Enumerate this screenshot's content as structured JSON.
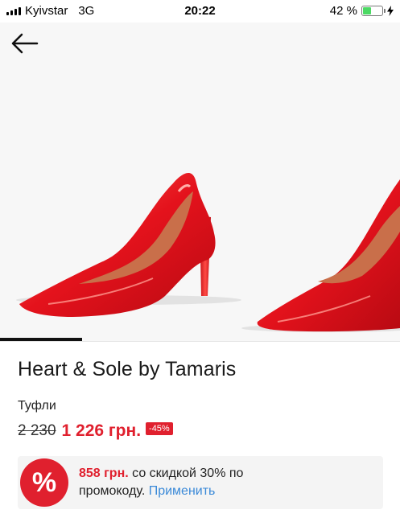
{
  "status_bar": {
    "carrier": "Kyivstar",
    "network": "3G",
    "time": "20:22",
    "battery_percent": "42 %",
    "battery_level": 0.42
  },
  "icons": {
    "back": "arrow-left-icon",
    "signal": "signal-icon",
    "battery": "battery-icon",
    "charging": "bolt-icon",
    "promo": "percent-icon"
  },
  "product": {
    "brand": "Heart & Sole by Tamaris",
    "category": "Туфли",
    "old_price": "2 230",
    "new_price": "1 226 грн.",
    "discount": "-45%"
  },
  "gallery": {
    "active_index": 0
  },
  "promo": {
    "symbol": "%",
    "price": "858 грн.",
    "text_1": "со скидкой 30% по",
    "text_2": "промокоду.",
    "apply_label": "Применить"
  },
  "colors": {
    "accent_red": "#e0202e",
    "link_blue": "#3b8ad8",
    "battery_green": "#4cd964"
  }
}
